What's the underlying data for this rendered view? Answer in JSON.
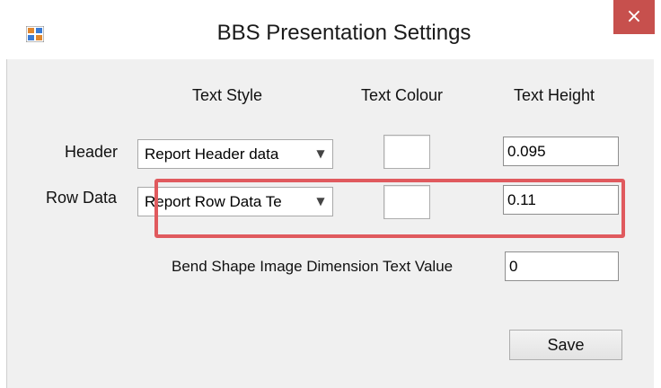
{
  "window": {
    "title": "BBS Presentation Settings",
    "close_label": "×"
  },
  "columns": {
    "text_style": "Text Style",
    "text_colour": "Text Colour",
    "text_height": "Text Height"
  },
  "rows": [
    {
      "label": "Header",
      "style_value": "Report Header data",
      "colour": "#ffffff",
      "height_value": "0.095"
    },
    {
      "label": "Row Data",
      "style_value": "Report Row Data Te",
      "colour": "#ffffff",
      "height_value": "0.11"
    }
  ],
  "bend_shape": {
    "label": "Bend Shape Image Dimension Text Value",
    "value": "0"
  },
  "buttons": {
    "save_label": "Save"
  },
  "colors": {
    "close_button": "#c7504d",
    "highlight_box": "#e05a5e",
    "client_background": "#f0f0f0"
  },
  "icons": {
    "app": "app-window-icon",
    "dropdown": "chevron-down-icon"
  }
}
